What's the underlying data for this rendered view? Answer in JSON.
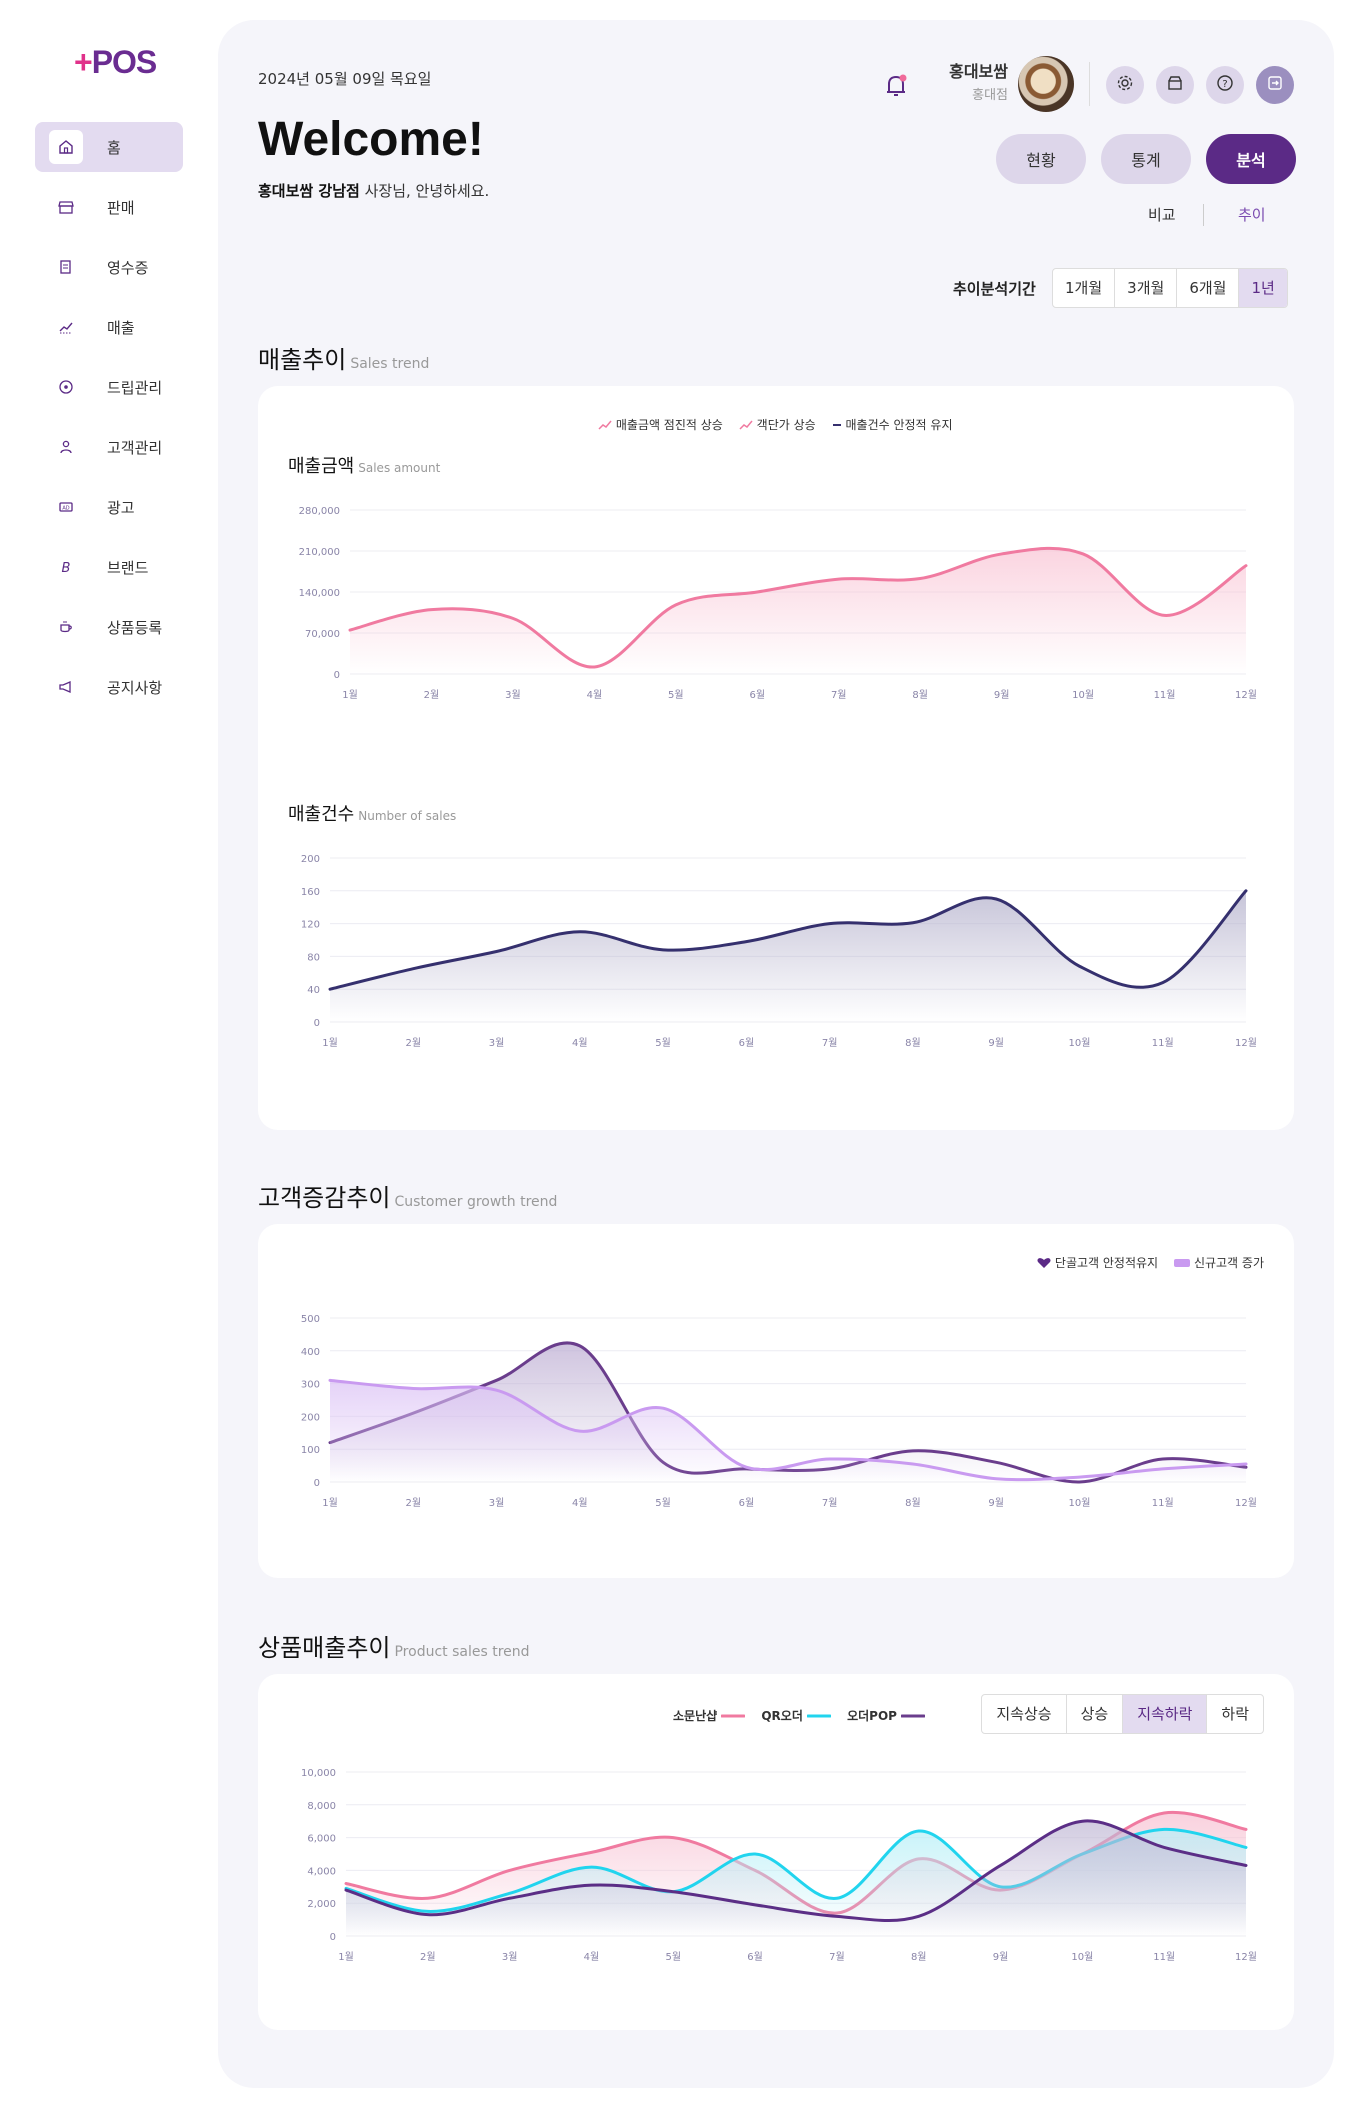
{
  "app": {
    "logo_plus": "+",
    "logo_text": "POS"
  },
  "sidebar": {
    "items": [
      {
        "label": "홈",
        "icon": "home-icon",
        "active": true
      },
      {
        "label": "판매",
        "icon": "store-icon"
      },
      {
        "label": "영수증",
        "icon": "receipt-icon"
      },
      {
        "label": "매출",
        "icon": "chart-icon"
      },
      {
        "label": "드립관리",
        "icon": "drip-icon"
      },
      {
        "label": "고객관리",
        "icon": "user-icon"
      },
      {
        "label": "광고",
        "icon": "ad-icon"
      },
      {
        "label": "브랜드",
        "icon": "brand-icon"
      },
      {
        "label": "상품등록",
        "icon": "coffee-icon"
      },
      {
        "label": "공지사항",
        "icon": "megaphone-icon"
      }
    ]
  },
  "header": {
    "date": "2024년 05월 09일 목요일",
    "user_name": "홍대보쌈",
    "user_store": "홍대점"
  },
  "welcome": {
    "title": "Welcome!",
    "store_bold": "홍대보쌈 강남점",
    "greeting_rest": " 사장님, 안녕하세요."
  },
  "main_tabs": [
    "현황",
    "통계",
    "분석"
  ],
  "main_tab_active": "분석",
  "sub_tabs": [
    "비교",
    "추이"
  ],
  "sub_tab_active": "추이",
  "period": {
    "label": "추이분석기간",
    "options": [
      "1개월",
      "3개월",
      "6개월",
      "1년"
    ],
    "active": "1년"
  },
  "colors": {
    "primary": "#5b2a86",
    "pink": "#f07aa0",
    "navy": "#35306e",
    "cyan": "#21d4ee",
    "lavender": "#c99af0",
    "purple": "#6a3d8c"
  },
  "sales_trend": {
    "title": "매출추이",
    "title_en": "Sales trend",
    "legend": [
      "매출금액 점진적 상승",
      "객단가 상승",
      "매출건수 안정적 유지"
    ],
    "amount_title": "매출금액",
    "amount_title_en": "Sales amount",
    "count_title": "매출건수",
    "count_title_en": "Number of sales"
  },
  "customer_trend": {
    "title": "고객증감추이",
    "title_en": "Customer growth trend",
    "legend": [
      "단골고객 안정적유지",
      "신규고객 증가"
    ]
  },
  "product_trend": {
    "title": "상품매출추이",
    "title_en": "Product sales trend",
    "legend": [
      "소문난샵",
      "QR오더",
      "오더POP"
    ],
    "filters": [
      "지속상승",
      "상승",
      "지속하락",
      "하락"
    ],
    "filter_active": "지속하락"
  },
  "chart_data": [
    {
      "type": "area",
      "title": "매출금액",
      "categories": [
        "1월",
        "2월",
        "3월",
        "4월",
        "5월",
        "6월",
        "7월",
        "8월",
        "9월",
        "10월",
        "11월",
        "12월"
      ],
      "ylim": [
        0,
        280000
      ],
      "yticks": [
        "0",
        "70,000",
        "140,000",
        "210,000",
        "280,000"
      ],
      "series": [
        {
          "values": [
            75000,
            110000,
            95000,
            12000,
            118000,
            140000,
            162000,
            163000,
            205000,
            205000,
            100000,
            185000
          ]
        }
      ]
    },
    {
      "type": "area",
      "title": "매출건수",
      "categories": [
        "1월",
        "2월",
        "3월",
        "4월",
        "5월",
        "6월",
        "7월",
        "8월",
        "9월",
        "10월",
        "11월",
        "12월"
      ],
      "ylim": [
        0,
        200
      ],
      "yticks": [
        "0",
        "40",
        "80",
        "120",
        "160",
        "200"
      ],
      "series": [
        {
          "values": [
            40,
            65,
            86,
            110,
            88,
            98,
            120,
            121,
            150,
            68,
            48,
            160
          ]
        }
      ]
    },
    {
      "type": "area",
      "title": "고객증감추이",
      "categories": [
        "1월",
        "2월",
        "3월",
        "4월",
        "5월",
        "6월",
        "7월",
        "8월",
        "9월",
        "10월",
        "11월",
        "12월"
      ],
      "ylim": [
        0,
        500
      ],
      "yticks": [
        "0",
        "100",
        "200",
        "300",
        "400",
        "500"
      ],
      "series": [
        {
          "name": "단골고객 안정적유지",
          "values": [
            120,
            210,
            310,
            415,
            60,
            40,
            40,
            95,
            60,
            0,
            70,
            45
          ]
        },
        {
          "name": "신규고객 증가",
          "values": [
            310,
            285,
            280,
            155,
            225,
            45,
            70,
            55,
            10,
            15,
            40,
            55
          ]
        }
      ]
    },
    {
      "type": "area",
      "title": "상품매출추이",
      "categories": [
        "1월",
        "2월",
        "3월",
        "4월",
        "5월",
        "6월",
        "7월",
        "8월",
        "9월",
        "10월",
        "11월",
        "12월"
      ],
      "ylim": [
        0,
        10000
      ],
      "yticks": [
        "0",
        "2,000",
        "4,000",
        "6,000",
        "8,000",
        "10,000"
      ],
      "series": [
        {
          "name": "소문난샵",
          "values": [
            3200,
            2300,
            4000,
            5100,
            6000,
            4000,
            1400,
            4700,
            2800,
            5000,
            7500,
            6500
          ]
        },
        {
          "name": "QR오더",
          "values": [
            2900,
            1500,
            2600,
            4200,
            2700,
            5000,
            2300,
            6400,
            3000,
            5000,
            6500,
            5400
          ]
        },
        {
          "name": "오더POP",
          "values": [
            2800,
            1300,
            2300,
            3100,
            2700,
            1900,
            1200,
            1200,
            4300,
            7000,
            5400,
            4300
          ]
        }
      ]
    }
  ]
}
